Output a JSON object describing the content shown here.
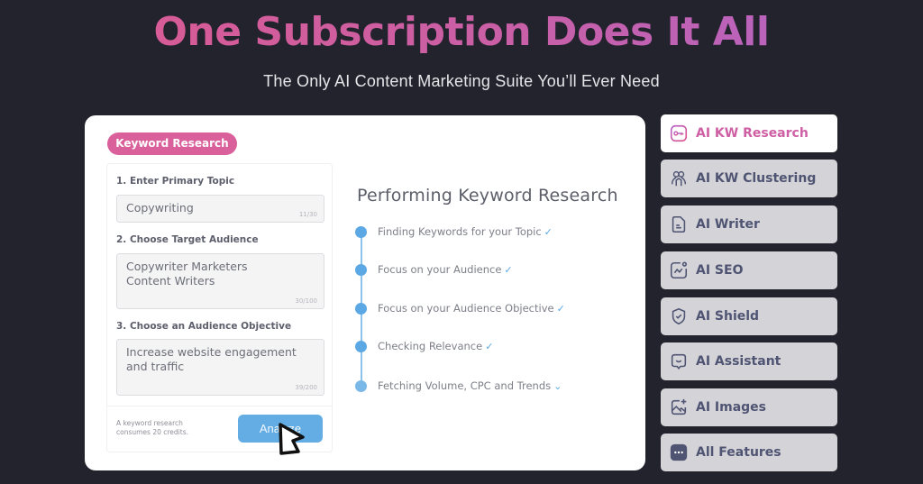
{
  "hero": {
    "title": "One Subscription Does It All",
    "subtitle": "The Only AI Content Marketing Suite You’ll Ever Need"
  },
  "demo": {
    "badge": "Keyword Research",
    "form": {
      "step1_label": "1. Enter Primary Topic",
      "step1_value": "Copywriting",
      "step1_count": "11/30",
      "step2_label": "2. Choose Target Audience",
      "step2_value": "Copywriter  Marketers\nContent Writers",
      "step2_count": "30/100",
      "step3_label": "3. Choose an Audience Objective",
      "step3_value": "Increase website engagement\nand traffic",
      "step3_count": "39/200",
      "credits_note": "A keyword research\nconsumes 20 credits.",
      "analyze_label": "Analyze"
    },
    "progress": {
      "title": "Performing Keyword Research",
      "steps": [
        {
          "label": "Finding Keywords for your Topic",
          "status": "✓"
        },
        {
          "label": "Focus on your Audience",
          "status": "✓"
        },
        {
          "label": "Focus on your Audience Objective",
          "status": "✓"
        },
        {
          "label": "Checking Relevance",
          "status": "✓"
        },
        {
          "label": "Fetching Volume, CPC and Trends",
          "status": "⌄"
        }
      ]
    }
  },
  "nav": {
    "items": [
      {
        "label": "AI KW Research",
        "icon": "key-icon",
        "active": true
      },
      {
        "label": "AI KW Clustering",
        "icon": "users-cluster-icon"
      },
      {
        "label": "AI Writer",
        "icon": "document-icon"
      },
      {
        "label": "AI SEO",
        "icon": "chart-trend-icon"
      },
      {
        "label": "AI Shield",
        "icon": "shield-check-icon"
      },
      {
        "label": "AI Assistant",
        "icon": "chat-bubble-icon"
      },
      {
        "label": "AI Images",
        "icon": "image-add-icon"
      },
      {
        "label": "All Features",
        "icon": "more-dots-icon"
      }
    ]
  },
  "colors": {
    "background": "#23232d",
    "accent_pink": "#d9609a",
    "accent_blue": "#63ade4",
    "nav_inactive": "#d4d4d8",
    "nav_text": "#4f5473"
  }
}
